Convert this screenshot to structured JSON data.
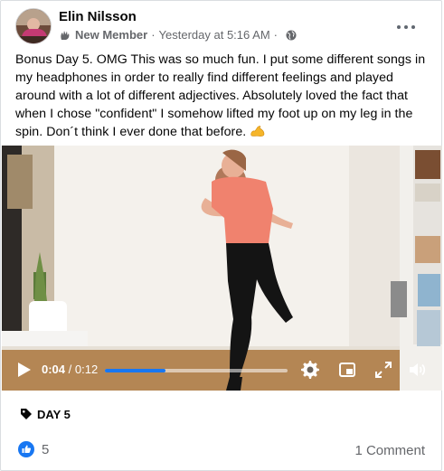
{
  "post": {
    "author": "Elin Nilsson",
    "role": "New Member",
    "separator": "·",
    "timestamp": "Yesterday at 5:16 AM",
    "separator2": "·",
    "text": "Bonus Day 5. OMG This was so much fun. I put some different songs in my headphones in order to really find different feelings and played around with a lot of different adjectives. Absolutely  loved the fact that when I chose \"confident\" I somehow lifted my foot up on my leg in the spin. Don´t think I ever done that before.",
    "emoji": "flexed-biceps-icon"
  },
  "video": {
    "current_time": "0:04",
    "time_separator": " / ",
    "duration": "0:12",
    "progress_fraction": 0.33
  },
  "tag": {
    "icon": "tag-icon",
    "label": "DAY 5"
  },
  "footer": {
    "reaction_icon": "like-icon",
    "reaction_count": "5",
    "comments": "1 Comment"
  },
  "colors": {
    "accent": "#1877f2",
    "secondary_text": "#65676b",
    "shirt": "#f0826e"
  }
}
